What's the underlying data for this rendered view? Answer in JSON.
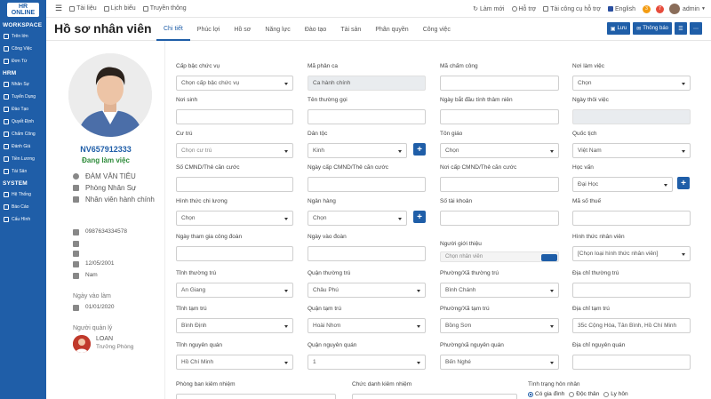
{
  "sidebar": {
    "logo": "HR ONLINE",
    "sections": [
      {
        "title": "WORKSPACE",
        "items": [
          "Trên lớn",
          "Công Việc",
          "Đơn Từ"
        ]
      },
      {
        "title": "HRM",
        "items": [
          "Nhân Sự",
          "Tuyển Dụng",
          "Đào Tạo",
          "Quyết Định",
          "Chấm Công",
          "Đánh Giá",
          "Tiền Lương",
          "Tài Sản"
        ]
      },
      {
        "title": "SYSTEM",
        "items": [
          "Hệ Thống",
          "Báo Cáo",
          "Cấu Hình"
        ]
      }
    ]
  },
  "topbar": {
    "items": [
      "Tài liệu",
      "Lịch biểu",
      "Truyền thông"
    ],
    "right": [
      "Làm mới",
      "Hỗ trợ",
      "Tài công cụ hỗ trợ",
      "English"
    ],
    "badge1": "3",
    "badge2": "7",
    "user": "admin"
  },
  "header": {
    "title": "Hồ sơ nhân viên",
    "tabs": [
      "Chi tiết",
      "Phúc lợi",
      "Hồ sơ",
      "Năng lực",
      "Đào tạo",
      "Tài sản",
      "Phân quyền",
      "Công việc"
    ],
    "save": "Lưu",
    "notify": "Thông báo"
  },
  "profile": {
    "code": "NV657912333",
    "status": "Đang làm việc",
    "name": "ĐÀM VĂN TIÊU",
    "department": "Phòng Nhân Sự",
    "position": "Nhân viên hành chính",
    "phone": "0987634334578",
    "dob": "12/05/2001",
    "gender": "Nam",
    "join_label": "Ngày vào làm",
    "join_date": "01/01/2020",
    "manager_label": "Người quản lý",
    "manager_name": "LOAN",
    "manager_role": "Trưởng Phòng"
  },
  "form": {
    "r1": [
      {
        "label": "Cấp bậc chức vụ",
        "value": "Chọn cấp bậc chức vụ"
      },
      {
        "label": "Mã phân ca",
        "value": "Ca hành chính"
      },
      {
        "label": "Mã chấm công",
        "value": ""
      },
      {
        "label": "Nơi làm việc",
        "value": "Chọn"
      }
    ],
    "r2": [
      {
        "label": "Nơi sinh",
        "value": ""
      },
      {
        "label": "Tên thường gọi",
        "value": ""
      },
      {
        "label": "Ngày bắt đầu tính thâm niên",
        "value": ""
      },
      {
        "label": "Ngày thôi việc",
        "value": ""
      }
    ],
    "r3": [
      {
        "label": "Cư trú",
        "value": "Chọn cư trú"
      },
      {
        "label": "Dân tộc",
        "value": "Kinh"
      },
      {
        "label": "Tôn giáo",
        "value": "Chọn"
      },
      {
        "label": "Quốc tịch",
        "value": "Việt Nam"
      }
    ],
    "r4": [
      {
        "label": "Số CMND/Thẻ căn cước",
        "value": ""
      },
      {
        "label": "Ngày cấp CMND/Thẻ căn cước",
        "value": ""
      },
      {
        "label": "Nơi cấp CMND/Thẻ căn cước",
        "value": ""
      },
      {
        "label": "Học vấn",
        "value": "Đại Học"
      }
    ],
    "r5": [
      {
        "label": "Hình thức chi lương",
        "value": "Chọn"
      },
      {
        "label": "Ngân hàng",
        "value": "Chọn"
      },
      {
        "label": "Số tài khoản",
        "value": ""
      },
      {
        "label": "Mã số thuế",
        "value": ""
      }
    ],
    "r6": [
      {
        "label": "Ngày tham gia công đoàn",
        "value": ""
      },
      {
        "label": "Ngày vào đoàn",
        "value": ""
      },
      {
        "label": "Người giới thiệu",
        "value": "Chọn nhân viên"
      },
      {
        "label": "Hình thức nhân viên",
        "value": "[Chọn loại hình thức nhân viên]"
      }
    ],
    "r7": [
      {
        "label": "Tỉnh thường trú",
        "value": "An Giang"
      },
      {
        "label": "Quận thường trú",
        "value": "Châu Phú"
      },
      {
        "label": "Phường/Xã thường trú",
        "value": "Bình Chánh"
      },
      {
        "label": "Địa chỉ thường trú",
        "value": ""
      }
    ],
    "r8": [
      {
        "label": "Tỉnh tạm trú",
        "value": "Bình Định"
      },
      {
        "label": "Quận tạm trú",
        "value": "Hoài Nhơn"
      },
      {
        "label": "Phường/Xã tạm trú",
        "value": "Bồng Sơn"
      },
      {
        "label": "Địa chỉ tạm trú",
        "value": "35c Cộng Hòa, Tân Bình, Hồ Chí Minh"
      }
    ],
    "r9": [
      {
        "label": "Tỉnh nguyên quán",
        "value": "Hồ Chí Minh"
      },
      {
        "label": "Quận nguyên quán",
        "value": "1"
      },
      {
        "label": "Phường/xã nguyên quán",
        "value": "Bến Nghé"
      },
      {
        "label": "Địa chỉ nguyên quán",
        "value": ""
      }
    ],
    "r10": {
      "dept": "Phòng ban kiêm nhiệm",
      "title": "Chức danh kiêm nhiệm",
      "marital": "Tình trạng hôn nhân",
      "options": [
        "Có gia đình",
        "Độc thân",
        "Ly hôn"
      ]
    }
  }
}
